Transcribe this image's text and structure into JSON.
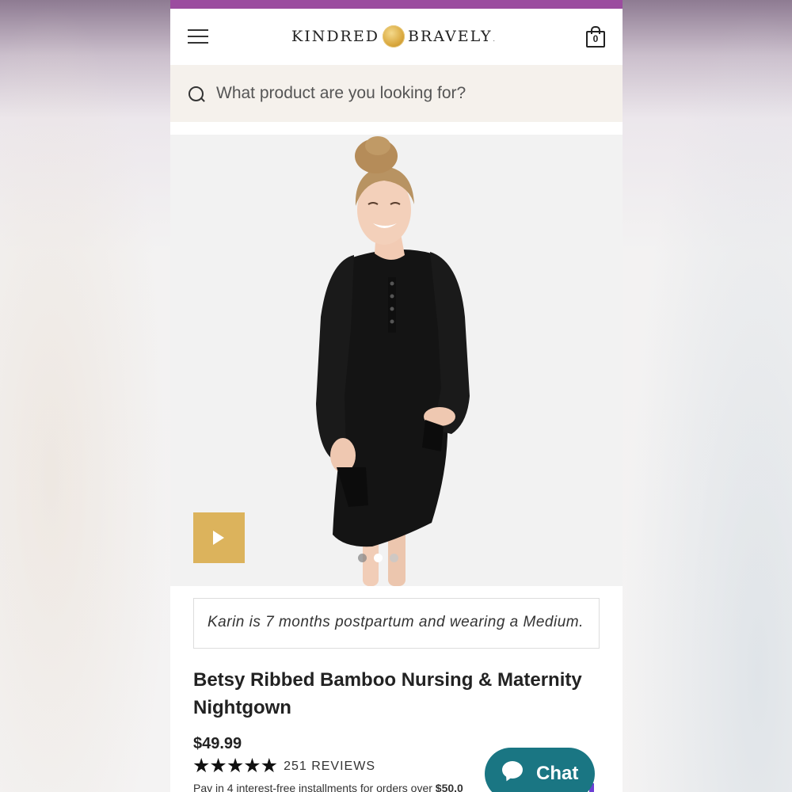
{
  "header": {
    "logo_left": "KINDRED",
    "logo_right": "BRAVELY",
    "logo_mark": ".",
    "cart_count": "0",
    "accent_stripe_color": "#9b4c9f"
  },
  "search": {
    "placeholder": "What product are you looking for?"
  },
  "gallery": {
    "slide_count": 3,
    "active_slide": 1,
    "play_button_color": "#dcb35c"
  },
  "product": {
    "model_caption": "Karin is 7 months postpartum and wearing a Medium.",
    "title": "Betsy Ribbed Bamboo Nursing & Maternity Nightgown",
    "price": "$49.99",
    "stars": "★★★★★",
    "rating": 5,
    "reviews": "251 REVIEWS",
    "installments_text": "Pay in 4 interest-free installments for orders over ",
    "installments_amount": "$50.0"
  },
  "chat": {
    "label": "Chat",
    "color": "#1a7683"
  },
  "icons": [
    "menu-icon",
    "cart-bag-icon",
    "search-icon",
    "play-icon",
    "chat-bubble-icon",
    "star-icon"
  ]
}
